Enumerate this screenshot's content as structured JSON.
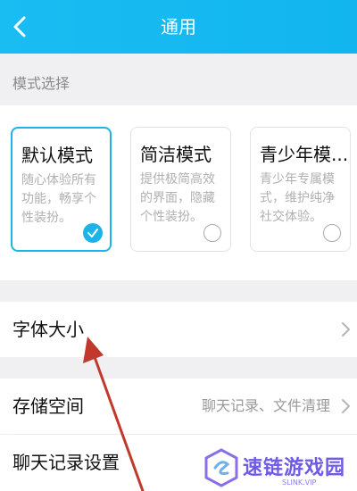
{
  "header": {
    "title": "通用",
    "back_icon": "chevron-left-icon",
    "background": "#19bdf2"
  },
  "section_label": "模式选择",
  "modes": [
    {
      "title": "默认模式",
      "description": "随心体验所有功能，畅享个性装扮。",
      "selected": true
    },
    {
      "title": "简洁模式",
      "description": "提供极简高效的界面，隐藏个性装扮。",
      "selected": false
    },
    {
      "title": "青少年模...",
      "description": "青少年专属模式，维护纯净社交体验。",
      "selected": false
    }
  ],
  "rows": {
    "font_size": {
      "label": "字体大小"
    },
    "storage": {
      "label": "存储空间",
      "value": "聊天记录、文件清理"
    },
    "chat_settings": {
      "label": "聊天记录设置"
    }
  },
  "watermark": {
    "text": "速链游戏园",
    "sub": "SLINK.VIP"
  },
  "colors": {
    "accent": "#1bb3e8",
    "annotation_arrow": "#c0392b",
    "watermark": "#6f5ae6"
  }
}
